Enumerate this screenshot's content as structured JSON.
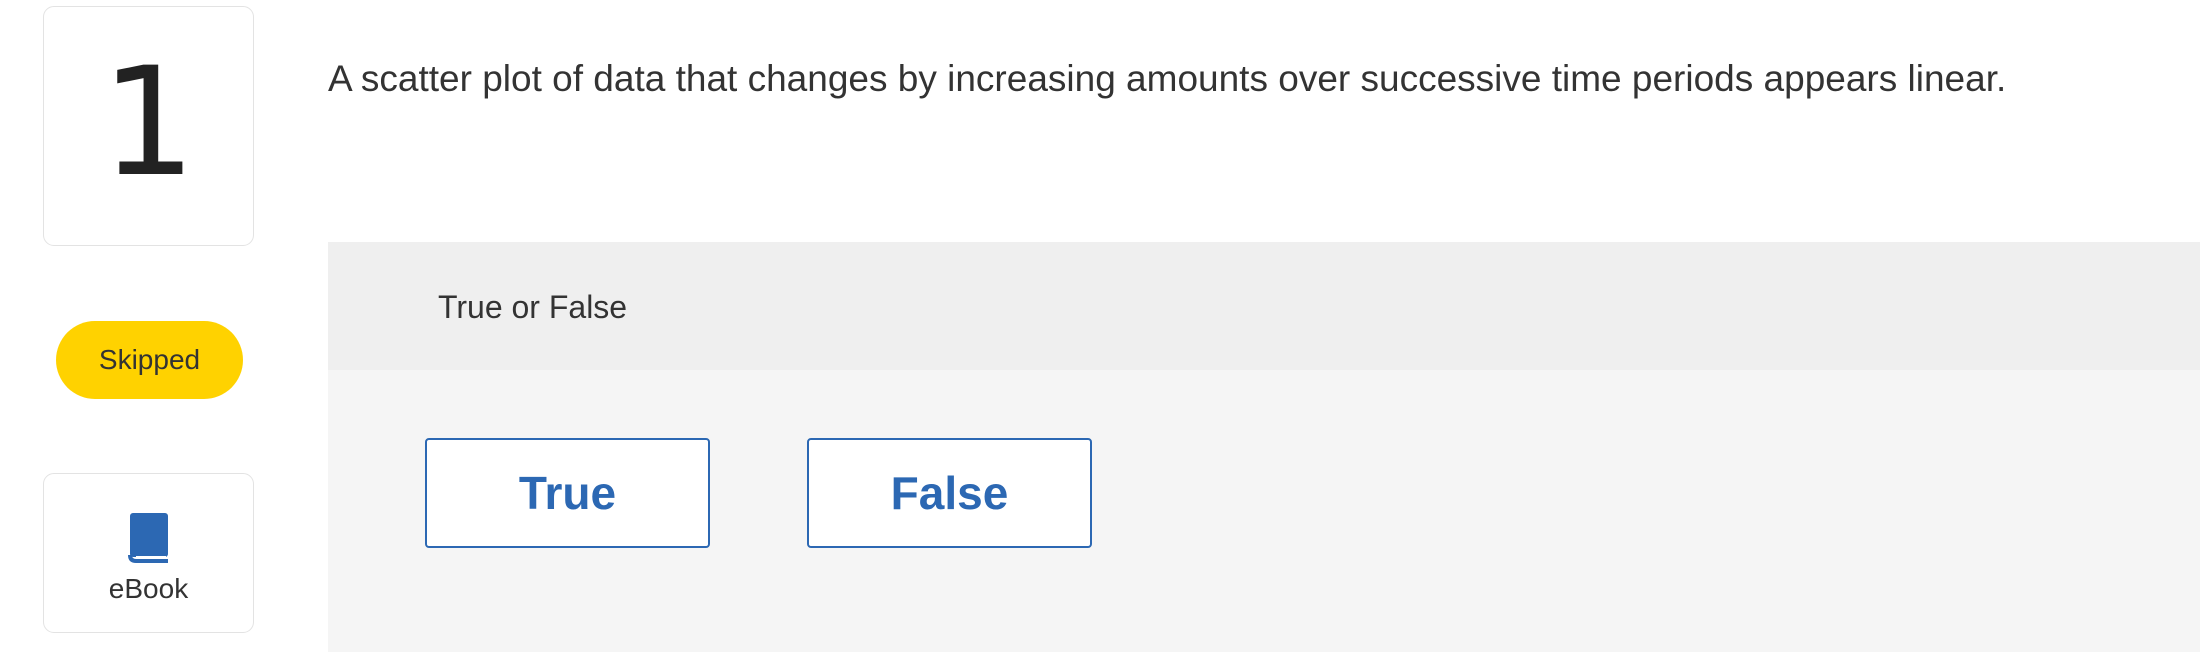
{
  "question": {
    "number": "1",
    "text": "A scatter plot of data that changes by increasing amounts over successive time periods appears linear.",
    "status": "Skipped",
    "status_color": "#ffd200"
  },
  "resources": {
    "ebook_label": "eBook",
    "ebook_icon": "book-icon",
    "ebook_icon_color": "#2c68b3"
  },
  "answer": {
    "type_label": "True or False",
    "options": [
      {
        "label": "True"
      },
      {
        "label": "False"
      }
    ],
    "accent_color": "#2c68b3"
  }
}
